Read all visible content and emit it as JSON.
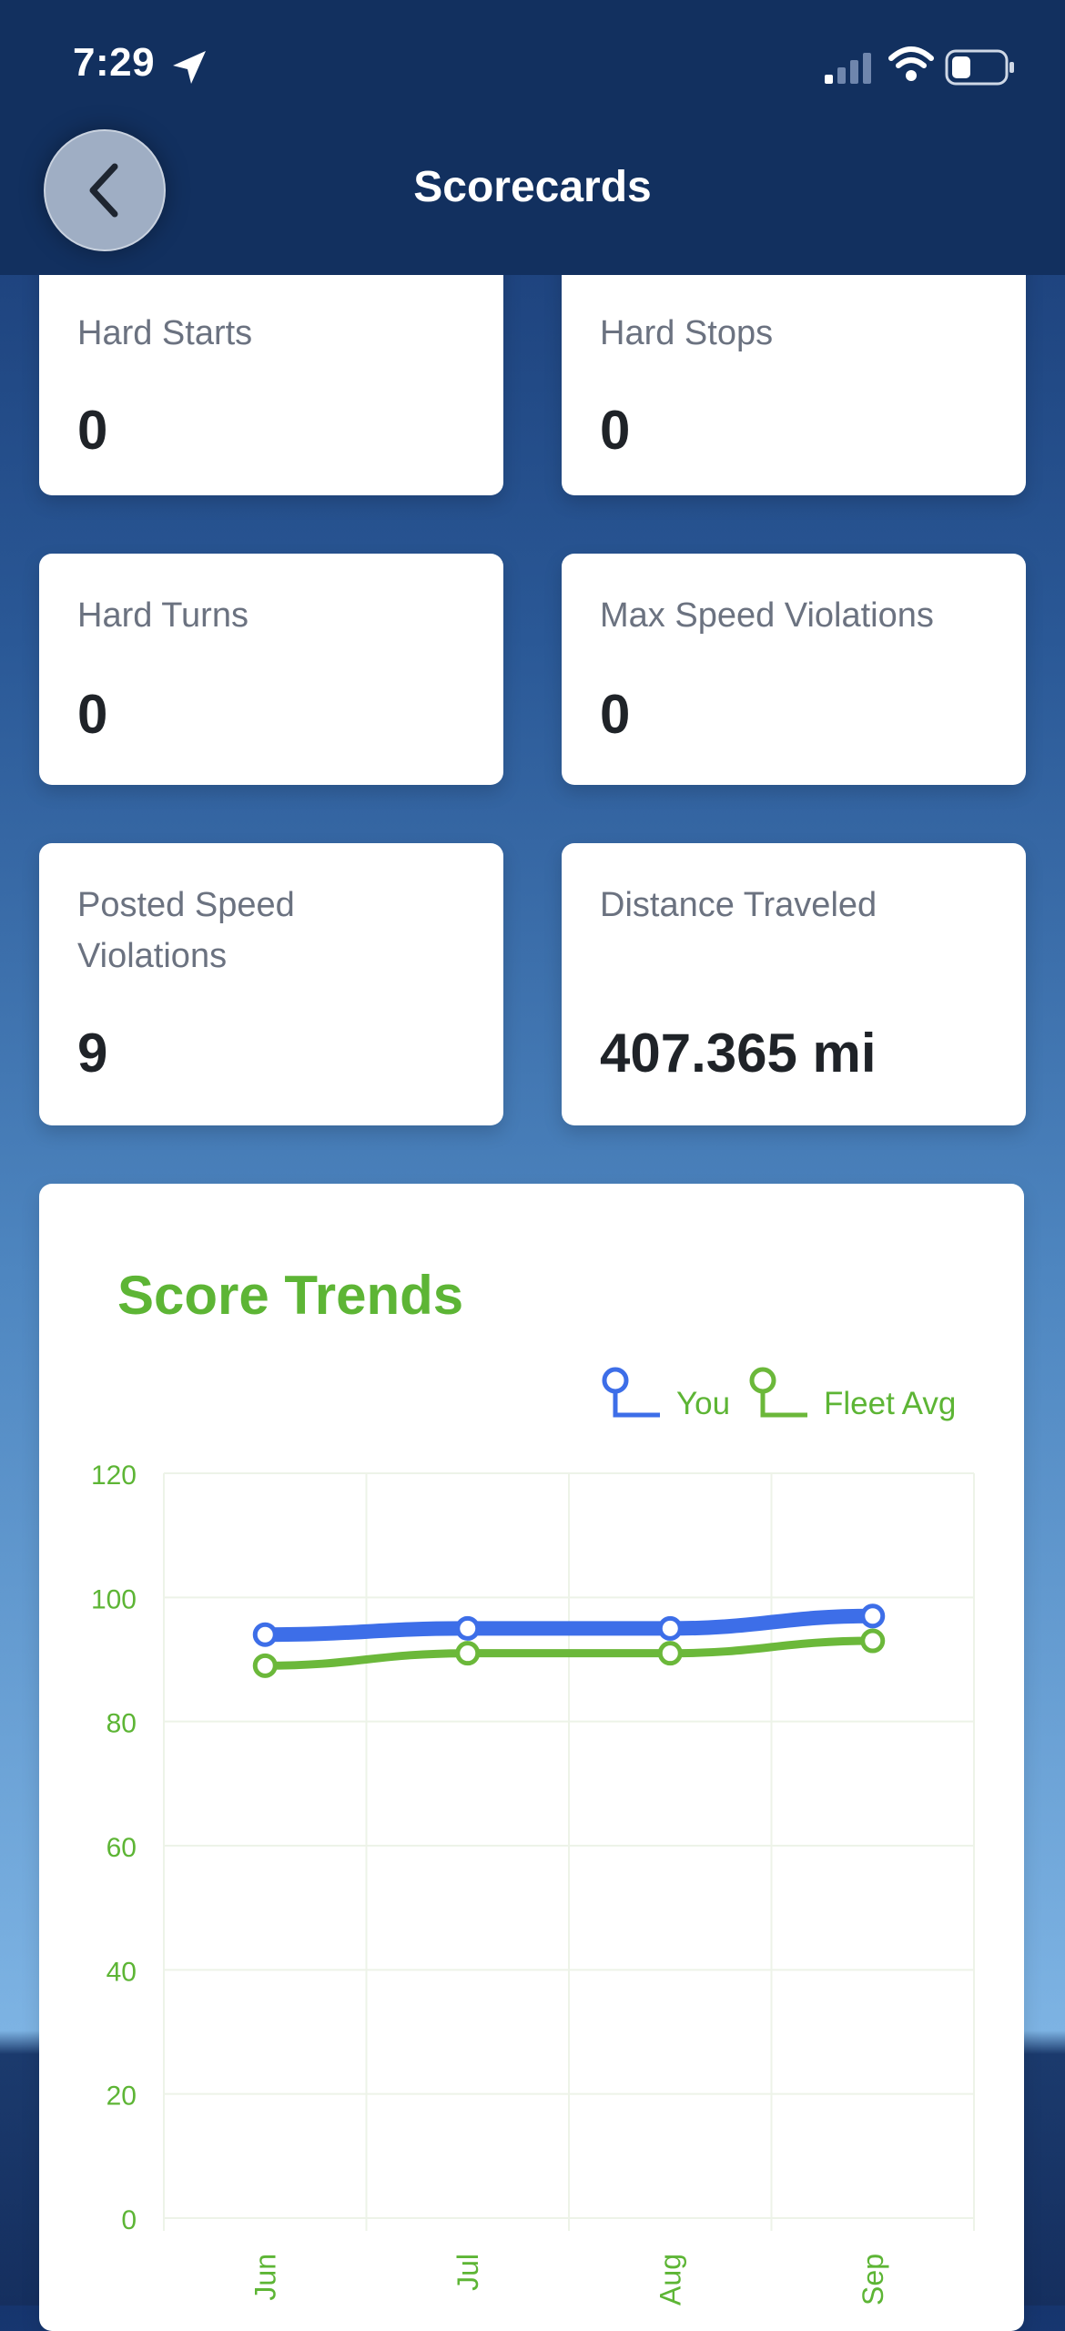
{
  "status_bar": {
    "time": "7:29"
  },
  "nav": {
    "title": "Scorecards"
  },
  "metrics": [
    {
      "label": "Hard Starts",
      "value": "0"
    },
    {
      "label": "Hard Stops",
      "value": "0"
    },
    {
      "label": "Hard Turns",
      "value": "0"
    },
    {
      "label": "Max Speed Violations",
      "value": "0"
    },
    {
      "label": "Posted Speed Violations",
      "value": "9"
    },
    {
      "label": "Distance Traveled",
      "value": "407.365 mi"
    }
  ],
  "colors": {
    "you": "#3d6ee8",
    "fleet": "#6bb83a",
    "accent": "#5db535",
    "header": "#12305f"
  },
  "chart_data": {
    "type": "line",
    "title": "Score Trends",
    "categories": [
      "Jun",
      "Jul",
      "Aug",
      "Sep"
    ],
    "series": [
      {
        "name": "You",
        "values": [
          94,
          95,
          95,
          97
        ]
      },
      {
        "name": "Fleet Avg",
        "values": [
          89,
          91,
          91,
          93
        ]
      }
    ],
    "ylim": [
      0,
      120
    ],
    "yticks": [
      0,
      20,
      40,
      60,
      80,
      100,
      120
    ],
    "grid": true,
    "legend": "top-right"
  }
}
